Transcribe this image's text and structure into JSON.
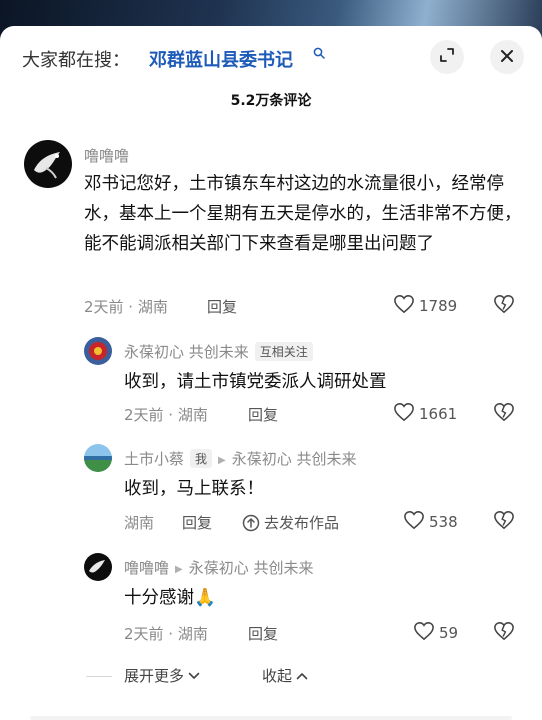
{
  "search": {
    "prefix": "大家都在搜：",
    "term": "邓群蓝山县委书记"
  },
  "comment_count": "5.2万条评论",
  "comments": [
    {
      "username": "噜噜噜",
      "text": "邓书记您好，土市镇东车村这边的水流量很小，经常停水，基本上一个星期有五天是停水的，生活非常不方便，能不能调派相关部门下来查看是哪里出问题了",
      "time": "2天前 · 湖南",
      "reply_label": "回复",
      "likes": "1789"
    }
  ],
  "replies": [
    {
      "username": "永葆初心 共创未来",
      "tag": "互相关注",
      "text": "收到，请土市镇党委派人调研处置",
      "time": "2天前 · 湖南",
      "reply_label": "回复",
      "likes": "1661"
    },
    {
      "username": "土市小蔡",
      "tag": "我",
      "reply_to": "永葆初心 共创未来",
      "text": "收到，马上联系！",
      "time": "湖南",
      "reply_label": "回复",
      "publish_label": "去发布作品",
      "likes": "538"
    },
    {
      "username": "噜噜噜",
      "reply_to": "永葆初心 共创未来",
      "text": "十分感谢",
      "emoji": "🙏",
      "time": "2天前 · 湖南",
      "reply_label": "回复",
      "likes": "59"
    }
  ],
  "footer": {
    "expand_more": "展开更多",
    "collapse": "收起"
  },
  "colors": {
    "accent_link": "#1e5bb8",
    "muted_text": "#8a8a8a",
    "emoji": "#f2a51c"
  },
  "icons": [
    "search-icon",
    "expand-icon",
    "close-icon",
    "heart-icon",
    "broken-heart-icon",
    "share-icon",
    "chevron-down-icon",
    "chevron-up-icon",
    "praying-hands-icon"
  ]
}
